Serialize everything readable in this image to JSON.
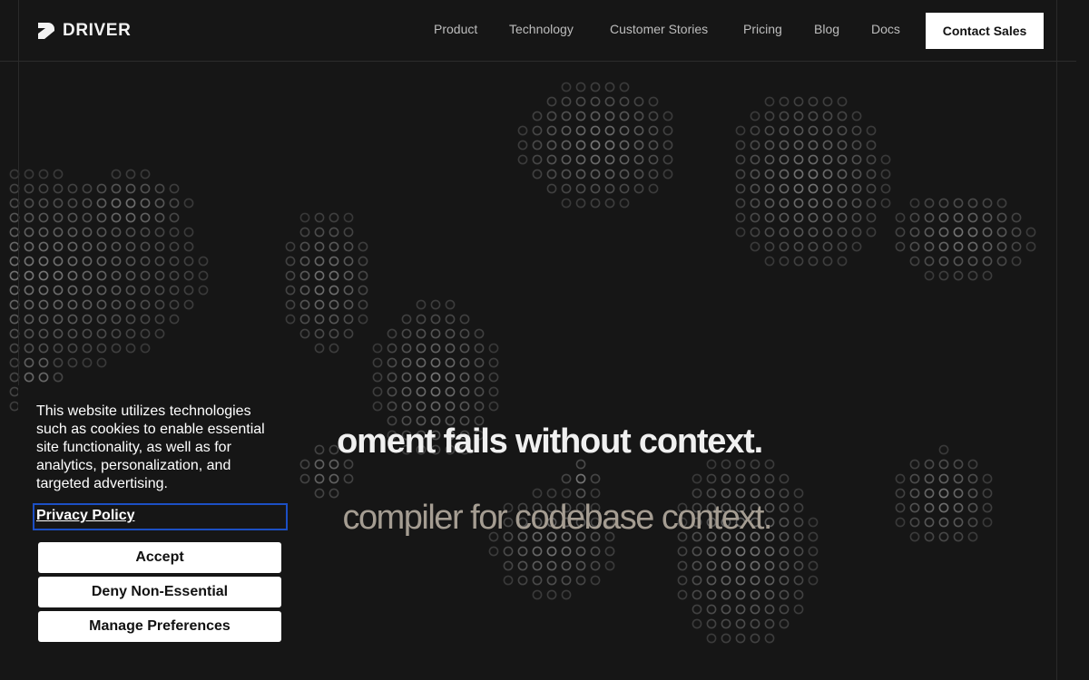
{
  "header": {
    "brand": "DRIVER",
    "nav": [
      {
        "label": "Product"
      },
      {
        "label": "Technology"
      },
      {
        "label": "Customer Stories"
      },
      {
        "label": "Pricing"
      },
      {
        "label": "Blog"
      },
      {
        "label": "Docs"
      }
    ],
    "cta_label": "Contact Sales"
  },
  "hero": {
    "title": "oment fails without context.",
    "subtitle": "compiler for codebase context."
  },
  "cookie_banner": {
    "message": "This website utilizes technologies such as cookies to enable essential site functionality, as well as for analytics, personalization, and targeted advertising.",
    "privacy_link": "Privacy Policy",
    "accept_label": "Accept",
    "deny_label": "Deny Non-Essential",
    "manage_label": "Manage Preferences"
  },
  "colors": {
    "background": "#161616",
    "text": "#f0f0f0",
    "subtitle": "#a59d92",
    "nav": "#bdbdbd",
    "focus_outline": "#1c4fc4"
  }
}
